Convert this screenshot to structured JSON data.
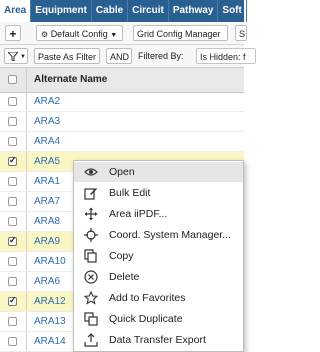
{
  "tabs": [
    "Area",
    "Equipment",
    "Cable",
    "Circuit",
    "Pathway",
    "Soft"
  ],
  "toolbar": {
    "add_label": "+",
    "config_label": "Default Config",
    "grid_config_label": "Grid Config Manager",
    "partial_label": "S"
  },
  "filterbar": {
    "paste_label": "Paste As Filter",
    "and_label": "AND",
    "filtered_by_label": "Filtered By:",
    "filter_value": "Is Hidden: f"
  },
  "grid": {
    "column": "Alternate Name",
    "rows": [
      {
        "name": "ARA2",
        "checked": false
      },
      {
        "name": "ARA3",
        "checked": false
      },
      {
        "name": "ARA4",
        "checked": false
      },
      {
        "name": "ARA5",
        "checked": true
      },
      {
        "name": "ARA1",
        "checked": false
      },
      {
        "name": "ARA7",
        "checked": false
      },
      {
        "name": "ARA8",
        "checked": false
      },
      {
        "name": "ARA9",
        "checked": true
      },
      {
        "name": "ARA10",
        "checked": false
      },
      {
        "name": "ARA6",
        "checked": false
      },
      {
        "name": "ARA12",
        "checked": true
      },
      {
        "name": "ARA13",
        "checked": false
      },
      {
        "name": "ARA14",
        "checked": false
      }
    ]
  },
  "context_menu": {
    "items": [
      {
        "label": "Open",
        "icon": "eye-icon"
      },
      {
        "label": "Bulk Edit",
        "icon": "edit-icon"
      },
      {
        "label": "Area iiPDF...",
        "icon": "move-icon"
      },
      {
        "label": "Coord. System Manager...",
        "icon": "crosshair-icon"
      },
      {
        "label": "Copy",
        "icon": "copy-icon"
      },
      {
        "label": "Delete",
        "icon": "delete-icon"
      },
      {
        "label": "Add to Favorites",
        "icon": "star-icon"
      },
      {
        "label": "Quick Duplicate",
        "icon": "duplicate-icon"
      },
      {
        "label": "Data Transfer Export",
        "icon": "export-icon"
      }
    ]
  },
  "colors": {
    "tab_bar": "#2a5f92",
    "link": "#2c6db0",
    "selected_row": "#fbf7c5"
  }
}
